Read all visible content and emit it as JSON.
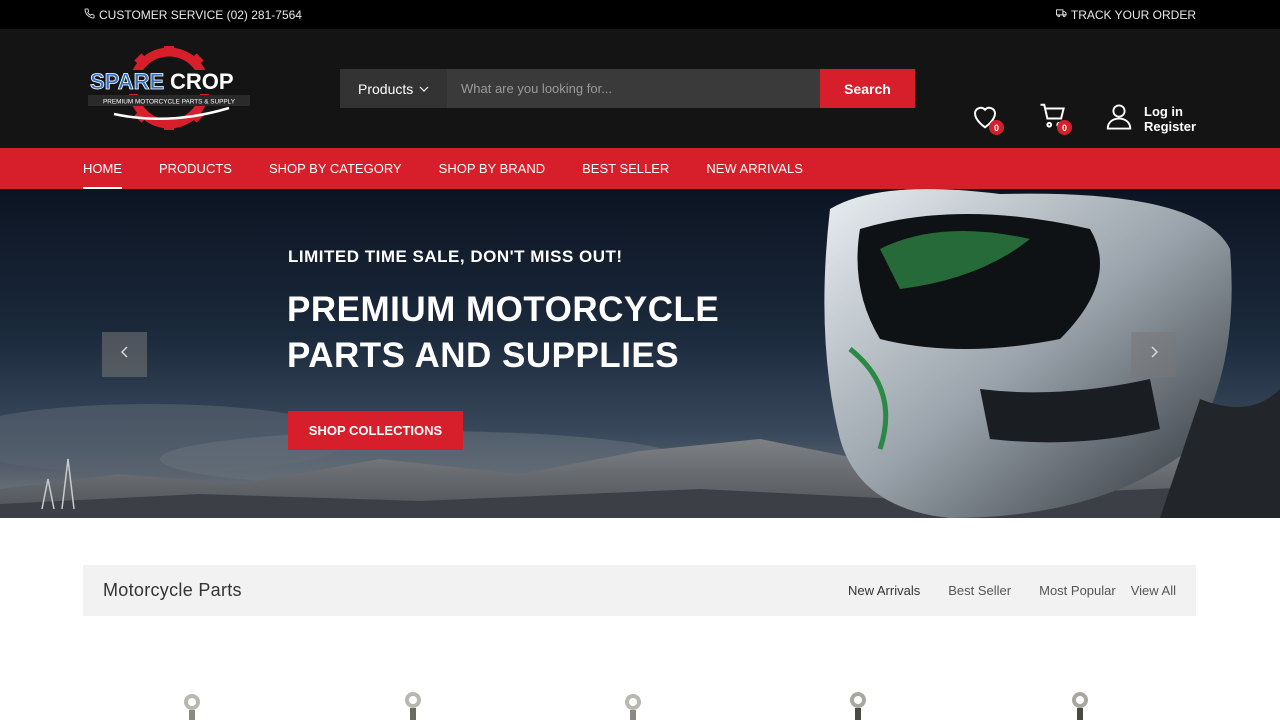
{
  "topbar": {
    "customer_service": "CUSTOMER SERVICE (02) 281-7564",
    "track_order": "TRACK YOUR ORDER"
  },
  "header": {
    "logo_text": "SPARECROP",
    "logo_tagline": "PREMIUM MOTORCYCLE PARTS & SUPPLY",
    "search_category": "Products",
    "search_placeholder": "What are you looking for...",
    "search_button": "Search",
    "wishlist_count": "0",
    "cart_count": "0",
    "login": "Log in",
    "register": "Register"
  },
  "nav": {
    "items": [
      "HOME",
      "PRODUCTS",
      "SHOP BY CATEGORY",
      "SHOP BY BRAND",
      "BEST SELLER",
      "NEW ARRIVALS"
    ]
  },
  "hero": {
    "kicker": "LIMITED TIME SALE, DON'T MISS OUT!",
    "headline_line1": "PREMIUM MOTORCYCLE",
    "headline_line2": "PARTS AND SUPPLIES",
    "cta": "SHOP COLLECTIONS"
  },
  "section": {
    "title": "Motorcycle Parts",
    "tabs": [
      "New Arrivals",
      "Best Seller",
      "Most Popular",
      "View All"
    ]
  },
  "colors": {
    "accent": "#d71f2b",
    "header_bg": "#141414",
    "topbar_bg": "#000000"
  },
  "icons": [
    "phone-icon",
    "truck-icon",
    "chevron-down-icon",
    "heart-icon",
    "cart-icon",
    "user-icon",
    "arrow-left-icon",
    "arrow-right-icon"
  ]
}
